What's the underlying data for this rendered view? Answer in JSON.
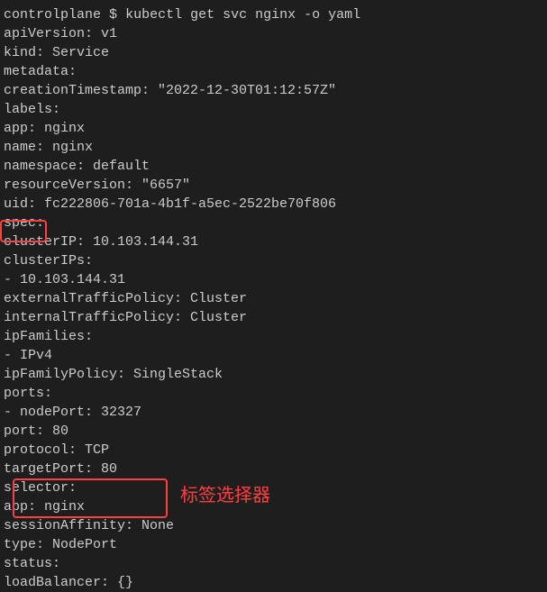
{
  "prompt": {
    "path": "controlplane",
    "symbol": "$",
    "command": "kubectl get svc nginx -o yaml"
  },
  "yaml": {
    "l1": "apiVersion: v1",
    "l2": "kind: Service",
    "l3": "metadata:",
    "l4": "  creationTimestamp: \"2022-12-30T01:12:57Z\"",
    "l5": "  labels:",
    "l6": "    app: nginx",
    "l7": "  name: nginx",
    "l8": "  namespace: default",
    "l9": "  resourceVersion: \"6657\"",
    "l10": "  uid: fc222806-701a-4b1f-a5ec-2522be70f806",
    "l11": "spec:",
    "l12": "  clusterIP: 10.103.144.31",
    "l13": "  clusterIPs:",
    "l14": "  - 10.103.144.31",
    "l15": "  externalTrafficPolicy: Cluster",
    "l16": "  internalTrafficPolicy: Cluster",
    "l17": "  ipFamilies:",
    "l18": "  - IPv4",
    "l19": "  ipFamilyPolicy: SingleStack",
    "l20": "  ports:",
    "l21": "  - nodePort: 32327",
    "l22": "    port: 80",
    "l23": "    protocol: TCP",
    "l24": "    targetPort: 80",
    "l25": "  selector:",
    "l26": "    app: nginx",
    "l27": "  sessionAffinity: None",
    "l28": "  type: NodePort",
    "l29": "status:",
    "l30": "  loadBalancer: {}"
  },
  "annotations": {
    "selector_label": "标签选择器"
  }
}
